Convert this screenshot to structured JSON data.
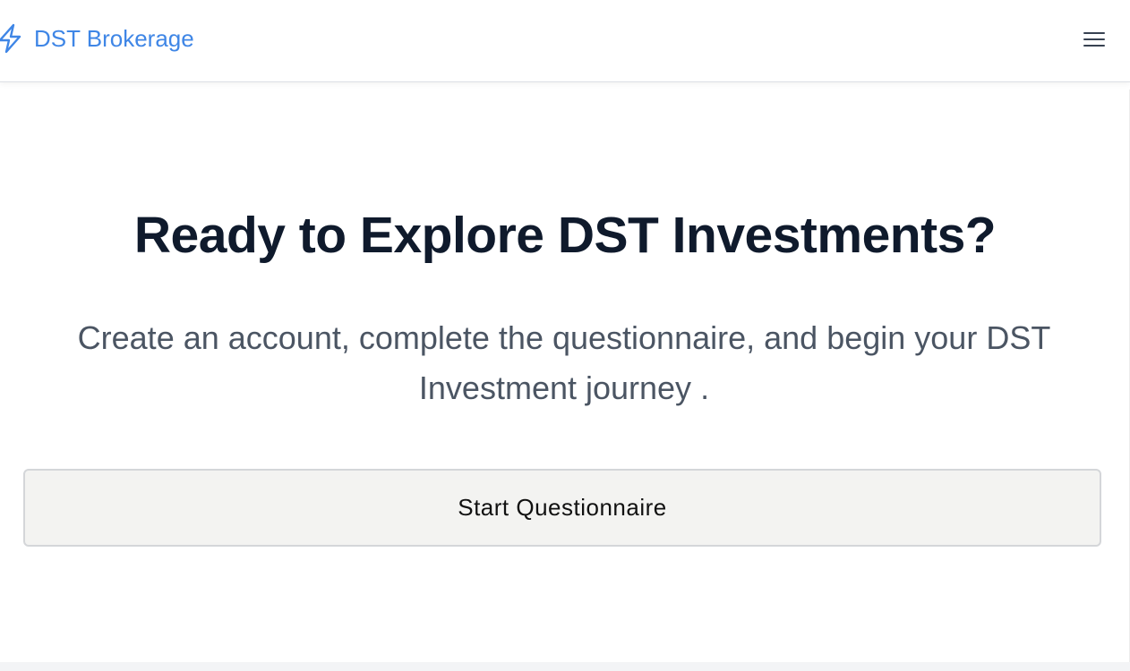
{
  "header": {
    "brand_icon": "lightning-bolt-icon",
    "brand_label": "DST Brokerage",
    "brand_color": "#3f86e6",
    "menu_icon": "hamburger-menu-icon"
  },
  "hero": {
    "headline": "Ready to Explore DST Investments?",
    "subtitle": "Create an account, complete the questionnaire, and begin your DST Investment journey .",
    "cta_label": "Start Questionnaire"
  },
  "colors": {
    "headline": "#0f1a2c",
    "subtitle": "#4b5563",
    "button_background": "#f3f3f1"
  }
}
